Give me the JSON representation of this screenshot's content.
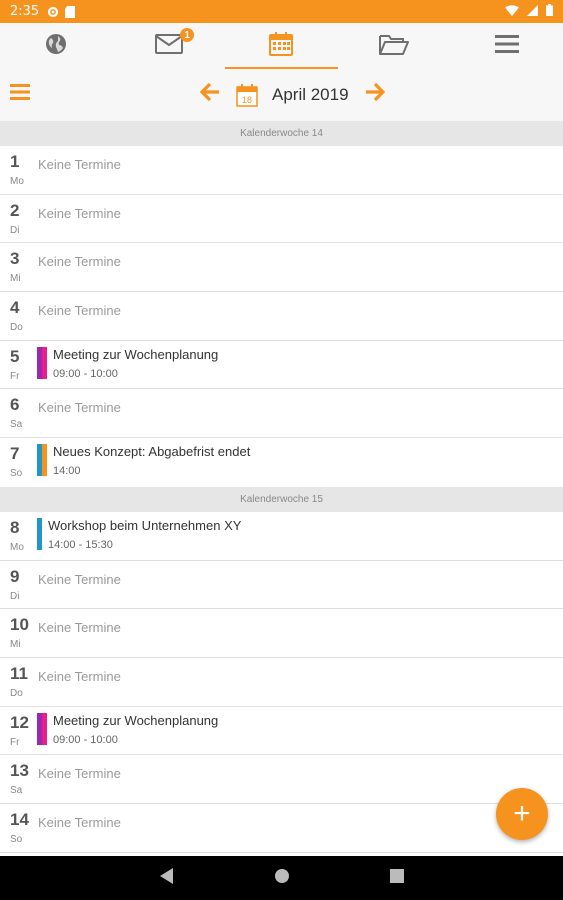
{
  "status_bar": {
    "time": "2:35"
  },
  "top_tabs": [
    {
      "name": "globe",
      "icon": "globe-icon"
    },
    {
      "name": "mail",
      "icon": "mail-icon",
      "badge": "1"
    },
    {
      "name": "calendar",
      "icon": "calendar-icon",
      "active": true
    },
    {
      "name": "folder",
      "icon": "folder-icon"
    },
    {
      "name": "menu",
      "icon": "hamburger-icon"
    }
  ],
  "header": {
    "month_label": "April 2019",
    "date_icon_day": "18"
  },
  "weeks": [
    {
      "label": "Kalenderwoche 14",
      "days": [
        {
          "num": "1",
          "abbr": "Mo",
          "empty_text": "Keine Termine"
        },
        {
          "num": "2",
          "abbr": "Di",
          "empty_text": "Keine Termine"
        },
        {
          "num": "3",
          "abbr": "Mi",
          "empty_text": "Keine Termine"
        },
        {
          "num": "4",
          "abbr": "Do",
          "empty_text": "Keine Termine"
        },
        {
          "num": "5",
          "abbr": "Fr",
          "event": {
            "title": "Meeting zur Wochenplanung",
            "time": "09:00 - 10:00",
            "colors": [
              "#9c27b0",
              "#e91e8c"
            ]
          }
        },
        {
          "num": "6",
          "abbr": "Sa",
          "empty_text": "Keine Termine"
        },
        {
          "num": "7",
          "abbr": "So",
          "event": {
            "title": "Neues Konzept: Abgabefrist endet",
            "time": "14:00",
            "colors": [
              "#2196c9",
              "#f6931e"
            ]
          }
        }
      ]
    },
    {
      "label": "Kalenderwoche 15",
      "days": [
        {
          "num": "8",
          "abbr": "Mo",
          "event": {
            "title": "Workshop beim Unternehmen XY",
            "time": "14:00 - 15:30",
            "colors": [
              "#2196c9"
            ]
          }
        },
        {
          "num": "9",
          "abbr": "Di",
          "empty_text": "Keine Termine"
        },
        {
          "num": "10",
          "abbr": "Mi",
          "empty_text": "Keine Termine"
        },
        {
          "num": "11",
          "abbr": "Do",
          "empty_text": "Keine Termine"
        },
        {
          "num": "12",
          "abbr": "Fr",
          "event": {
            "title": "Meeting zur Wochenplanung",
            "time": "09:00 - 10:00",
            "colors": [
              "#9c27b0",
              "#e91e8c"
            ]
          }
        },
        {
          "num": "13",
          "abbr": "Sa",
          "empty_text": "Keine Termine"
        },
        {
          "num": "14",
          "abbr": "So",
          "empty_text": "Keine Termine"
        }
      ]
    }
  ],
  "fab": {
    "label": "+"
  },
  "colors": {
    "accent": "#f6931e",
    "divider": "#dedede",
    "week_header_bg": "#e6e6e6"
  }
}
